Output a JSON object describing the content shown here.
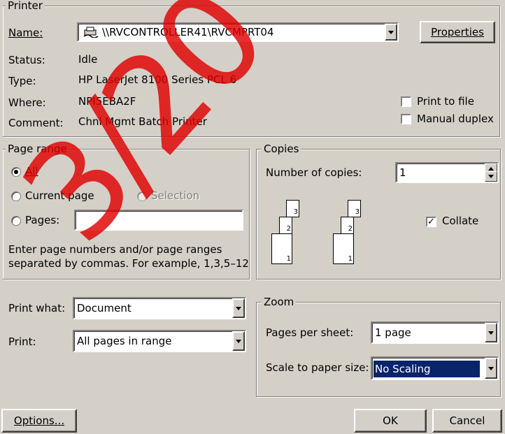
{
  "printer": {
    "group_label": "Printer",
    "name_label": "Name:",
    "name_value": "\\\\RVCONTROLLER41\\RVCMPRT04",
    "properties_button": "Properties",
    "status_label": "Status:",
    "status_value": "Idle",
    "type_label": "Type:",
    "type_value": "HP LaserJet 8100 Series PCL 6",
    "where_label": "Where:",
    "where_value": "NPI5EBA2F",
    "comment_label": "Comment:",
    "comment_value": "Chnl Mgmt Batch Printer",
    "print_to_file": "Print to file",
    "manual_duplex": "Manual duplex"
  },
  "page_range": {
    "group_label": "Page range",
    "all": "All",
    "current_page": "Current page",
    "selection": "Selection",
    "pages": "Pages:",
    "pages_value": "",
    "help_line1": "Enter page numbers and/or page ranges",
    "help_line2": "separated by commas.  For example, 1,3,5–12"
  },
  "copies": {
    "group_label": "Copies",
    "number_label": "Number of copies:",
    "number_value": "1",
    "collate": "Collate",
    "page_numbers": [
      "3",
      "2",
      "1"
    ]
  },
  "print_what": {
    "label": "Print what:",
    "value": "Document"
  },
  "print": {
    "label": "Print:",
    "value": "All pages in range"
  },
  "zoom": {
    "group_label": "Zoom",
    "pages_per_sheet_label": "Pages per sheet:",
    "pages_per_sheet_value": "1 page",
    "scale_label": "Scale to paper size:",
    "scale_value": "No Scaling"
  },
  "buttons": {
    "options": "Options...",
    "ok": "OK",
    "cancel": "Cancel"
  },
  "watermark": "3/20",
  "colors": {
    "face": "#d4d0c8",
    "highlight": "#0a246a",
    "watermark": "#e10000"
  }
}
